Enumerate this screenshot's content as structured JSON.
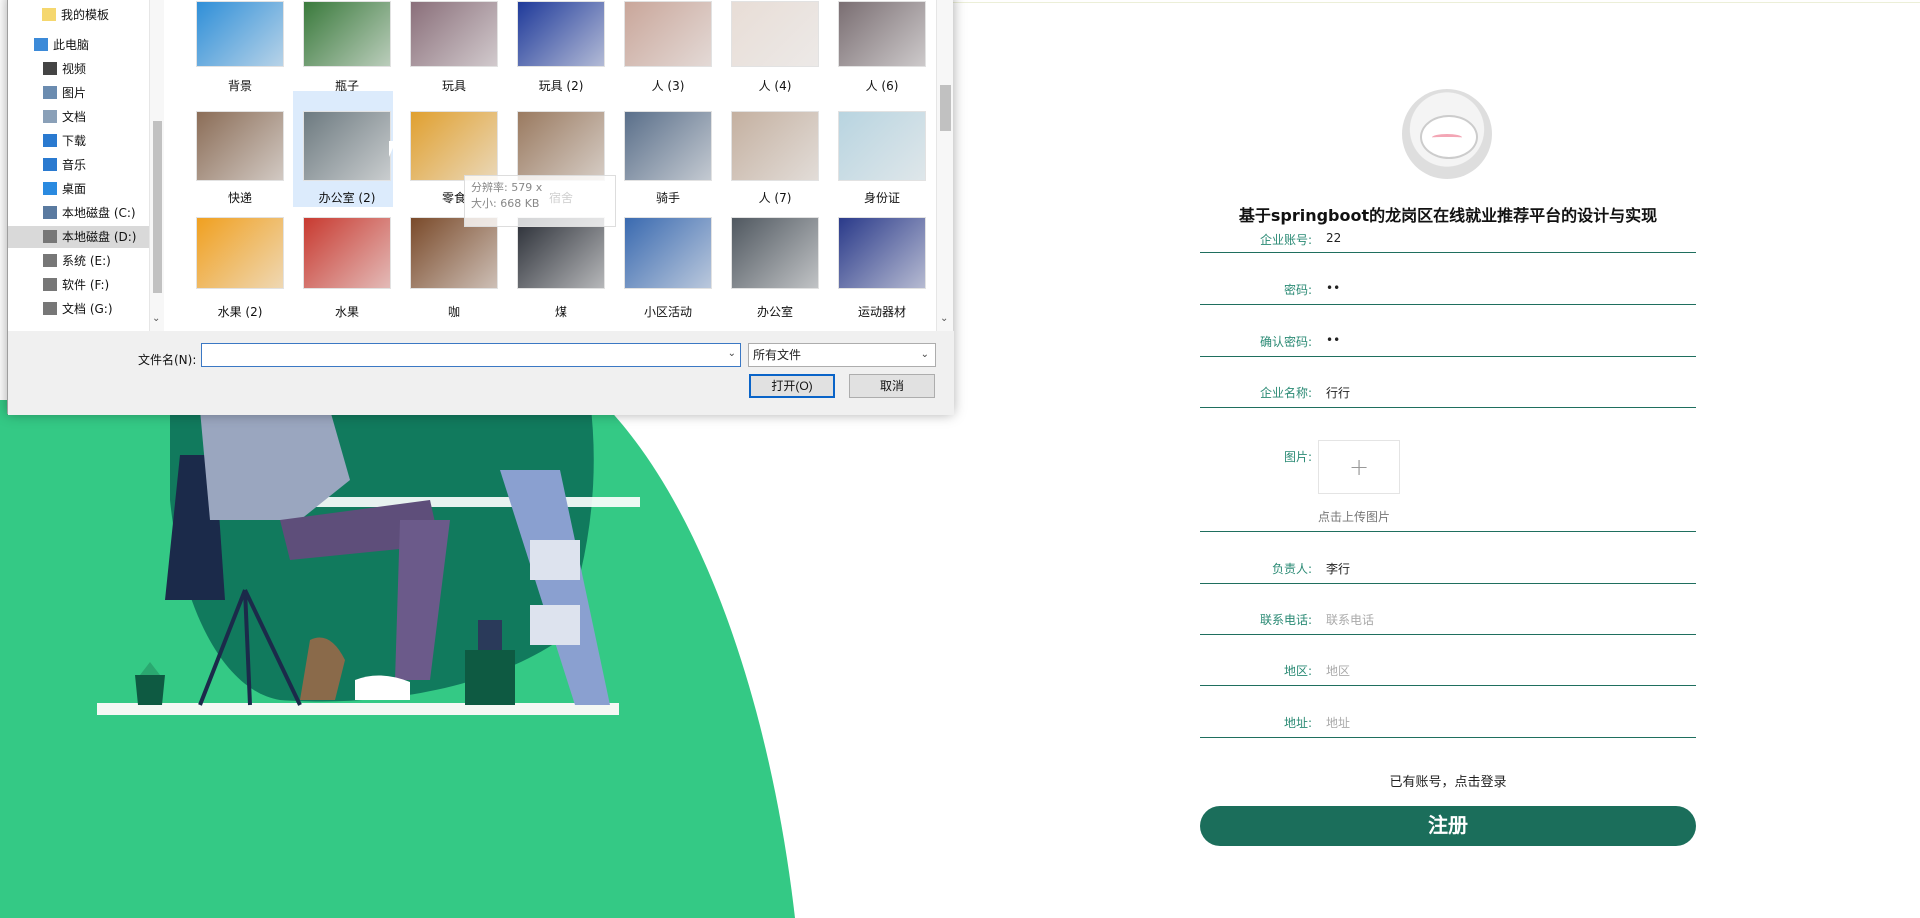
{
  "dialog": {
    "nav_items": [
      {
        "label": "我的模板",
        "icon": "folder-icon"
      },
      {
        "label": "此电脑",
        "icon": "computer-icon"
      },
      {
        "label": "视频",
        "icon": "video-folder-icon"
      },
      {
        "label": "图片",
        "icon": "pictures-folder-icon"
      },
      {
        "label": "文档",
        "icon": "documents-folder-icon"
      },
      {
        "label": "下载",
        "icon": "download-icon"
      },
      {
        "label": "音乐",
        "icon": "music-icon"
      },
      {
        "label": "桌面",
        "icon": "desktop-icon"
      },
      {
        "label": "本地磁盘 (C:)",
        "icon": "system-drive-icon"
      },
      {
        "label": "本地磁盘 (D:)",
        "icon": "drive-icon"
      },
      {
        "label": "系统 (E:)",
        "icon": "drive-icon"
      },
      {
        "label": "软件 (F:)",
        "icon": "drive-icon"
      },
      {
        "label": "文档 (G:)",
        "icon": "drive-icon"
      }
    ],
    "selected_nav": "本地磁盘 (D:)",
    "files": [
      {
        "label": "背景",
        "color": "#2f8fd8"
      },
      {
        "label": "瓶子",
        "color": "#3a7a3c"
      },
      {
        "label": "玩具",
        "color": "#8a6f7a"
      },
      {
        "label": "玩具 (2)",
        "color": "#1f3a9a"
      },
      {
        "label": "人 (3)",
        "color": "#c9a69a"
      },
      {
        "label": "人 (4)",
        "color": "#e8ddd6"
      },
      {
        "label": "人 (6)",
        "color": "#7a6e72"
      },
      {
        "label": "快递",
        "color": "#8b6d57"
      },
      {
        "label": "办公室 (2)",
        "color": "#6d7a80"
      },
      {
        "label": "零食",
        "color": "#e0a030"
      },
      {
        "label": "宿舍",
        "color": "#9a7a60"
      },
      {
        "label": "骑手",
        "color": "#5a6f8a"
      },
      {
        "label": "人 (7)",
        "color": "#c4b0a0"
      },
      {
        "label": "身份证",
        "color": "#b8d4e0"
      },
      {
        "label": "水果 (2)",
        "color": "#f0a020"
      },
      {
        "label": "水果",
        "color": "#c83a30"
      },
      {
        "label": "咖",
        "color": "#7a4a2a"
      },
      {
        "label": "煤",
        "color": "#2a2e36"
      },
      {
        "label": "小区活动",
        "color": "#3a6ab0"
      },
      {
        "label": "办公室",
        "color": "#505860"
      },
      {
        "label": "运动器材",
        "color": "#2a3a8a"
      }
    ],
    "selected_file": "办公室 (2)",
    "tooltip_lines": [
      "分辨率: 579 x",
      "大小: 668 KB"
    ],
    "filename_label": "文件名(N):",
    "filename_value": "",
    "filter_value": "所有文件",
    "open_label": "打开(O)",
    "cancel_label": "取消"
  },
  "form": {
    "title": "基于springboot的龙岗区在线就业推荐平台的设计与实现",
    "fields": [
      {
        "label": "企业账号:",
        "value": "22",
        "placeholder": ""
      },
      {
        "label": "密码:",
        "value": "••",
        "placeholder": ""
      },
      {
        "label": "确认密码:",
        "value": "••",
        "placeholder": ""
      },
      {
        "label": "企业名称:",
        "value": "行行",
        "placeholder": ""
      },
      {
        "label": "图片:",
        "value": "",
        "placeholder": ""
      },
      {
        "label": "负责人:",
        "value": "李行",
        "placeholder": ""
      },
      {
        "label": "联系电话:",
        "value": "",
        "placeholder": "联系电话"
      },
      {
        "label": "地区:",
        "value": "",
        "placeholder": "地区"
      },
      {
        "label": "地址:",
        "value": "",
        "placeholder": "地址"
      }
    ],
    "upload_tip": "点击上传图片",
    "login_link": "已有账号，点击登录",
    "submit_label": "注册"
  },
  "colors": {
    "accent": "#1b6e5b",
    "label": "#2a8a74",
    "bg_green": "#34c985",
    "dark_green": "#117a5d"
  }
}
